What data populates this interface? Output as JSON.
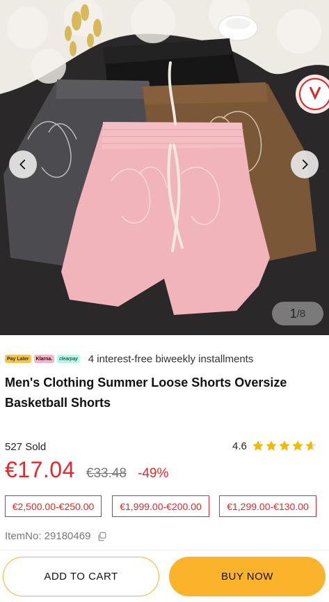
{
  "gallery": {
    "current": "1",
    "separator": "/",
    "total": "8",
    "prev_icon": "chevron-left-icon",
    "next_icon": "chevron-right-icon",
    "image": "product-photo-shorts"
  },
  "payment": {
    "badges": [
      "Pay Later",
      "Klarna.",
      "clearpay"
    ],
    "text": "4 interest-free biweekly installments"
  },
  "product": {
    "title": "Men's Clothing Summer Loose Shorts Oversize Basketball Shorts",
    "sold": "527 Sold",
    "rating": "4.6",
    "rating_value": 4.6,
    "price": "€17.04",
    "original_price": "€33.48",
    "discount": "-49%",
    "item_no": "ItemNo: 29180469"
  },
  "coupons": [
    "€2,500.00-€250.00",
    "€1,999.00-€200.00",
    "€1,299.00-€130.00"
  ],
  "actions": {
    "add_to_cart": "ADD TO CART",
    "buy_now": "BUY NOW"
  },
  "colors": {
    "accent_red": "#e5262b",
    "button_yellow": "#fbb32b",
    "star_yellow": "#f5b800"
  }
}
